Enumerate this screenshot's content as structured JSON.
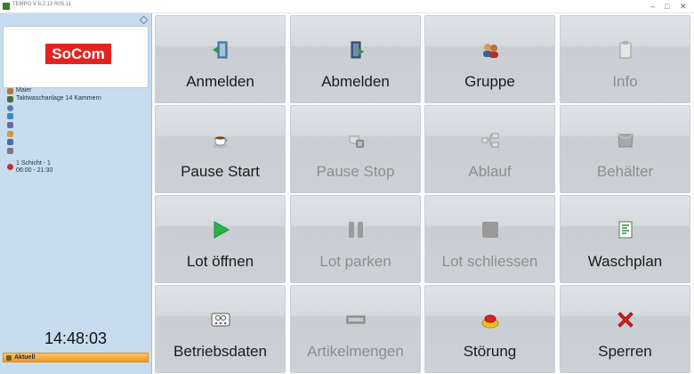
{
  "window": {
    "title": "TEMPO V 8.2.13 R05.11",
    "min_glyph": "–",
    "max_glyph": "□",
    "close_glyph": "✕"
  },
  "sidebar": {
    "logo_text": "SoCom",
    "user": "Maier",
    "machine": "Taktwaschanlage 14 Kammern",
    "shift_line1": "1 Schicht - 1",
    "shift_line2": "06:00 - 21:30",
    "clock": "14:48:03",
    "current_label": "Aktuell"
  },
  "tiles": [
    {
      "label": "Anmelden",
      "icon": "login-door-icon",
      "enabled": true
    },
    {
      "label": "Abmelden",
      "icon": "logout-door-icon",
      "enabled": true
    },
    {
      "label": "Gruppe",
      "icon": "group-users-icon",
      "enabled": true
    },
    {
      "label": "Info",
      "icon": "clipboard-icon",
      "enabled": false
    },
    {
      "label": "Pause Start",
      "icon": "coffee-cup-icon",
      "enabled": true
    },
    {
      "label": "Pause Stop",
      "icon": "coffee-stop-icon",
      "enabled": false
    },
    {
      "label": "Ablauf",
      "icon": "flow-icon",
      "enabled": false
    },
    {
      "label": "Behälter",
      "icon": "container-icon",
      "enabled": false
    },
    {
      "label": "Lot öffnen",
      "icon": "play-icon",
      "enabled": true
    },
    {
      "label": "Lot parken",
      "icon": "pause-icon",
      "enabled": false
    },
    {
      "label": "Lot schliessen",
      "icon": "stop-icon",
      "enabled": false
    },
    {
      "label": "Waschplan",
      "icon": "plan-document-icon",
      "enabled": true
    },
    {
      "label": "Betriebsdaten",
      "icon": "machine-data-icon",
      "enabled": true
    },
    {
      "label": "Artikelmengen",
      "icon": "article-counter-icon",
      "enabled": false
    },
    {
      "label": "Störung",
      "icon": "alarm-button-icon",
      "enabled": true
    },
    {
      "label": "Sperren",
      "icon": "red-x-icon",
      "enabled": true
    }
  ],
  "colors": {
    "sidebar_bg": "#c8dcf0",
    "logo_red": "#e4231f",
    "aktuell_orange": "#f39a1f",
    "tile_bg": "#d6dade",
    "play_green": "#2db14a",
    "sperren_red": "#d8231f"
  }
}
